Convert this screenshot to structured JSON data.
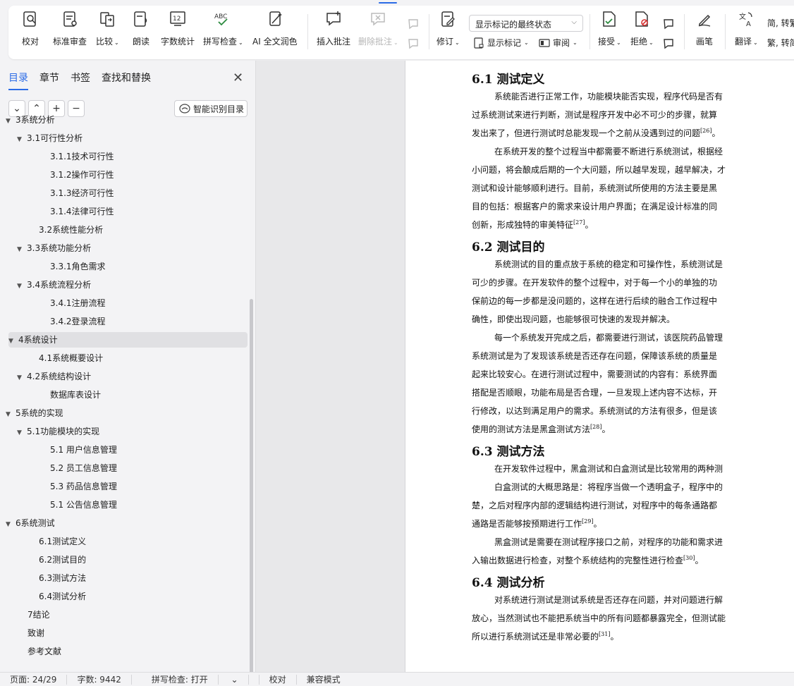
{
  "ribbon": {
    "buttons": [
      {
        "label": "校对"
      },
      {
        "label": "标准审查"
      },
      {
        "label": "比较"
      },
      {
        "label": "朗读"
      },
      {
        "label": "字数统计"
      },
      {
        "label": "拼写检查"
      },
      {
        "label": "AI 全文润色"
      },
      {
        "label": "插入批注"
      },
      {
        "label": "删除批注"
      },
      {
        "label": "修订"
      },
      {
        "label": "接受"
      },
      {
        "label": "拒绝"
      },
      {
        "label": "画笔"
      },
      {
        "label": "翻译"
      }
    ],
    "markup_dropdown": "显示标记的最终状态",
    "show_markup": "显示标记",
    "review_pane": "审阅",
    "convert_1": "简, 转繁",
    "convert_2": "繁, 转简"
  },
  "nav": {
    "tabs": [
      "目录",
      "章节",
      "书签",
      "查找和替换"
    ],
    "smart_toc": "智能识别目录",
    "toc": [
      {
        "text": "3系统分析",
        "level": 0
      },
      {
        "text": "3.1可行性分析",
        "level": 1
      },
      {
        "text": "3.1.1技术可行性",
        "level": 2
      },
      {
        "text": "3.1.2操作可行性",
        "level": 2
      },
      {
        "text": "3.1.3经济可行性",
        "level": 2
      },
      {
        "text": "3.1.4法律可行性",
        "level": 2
      },
      {
        "text": "3.2系统性能分析",
        "level": 1
      },
      {
        "text": "3.3系统功能分析",
        "level": 1
      },
      {
        "text": "3.3.1角色需求",
        "level": 2
      },
      {
        "text": "3.4系统流程分析",
        "level": 1
      },
      {
        "text": "3.4.1注册流程",
        "level": 2
      },
      {
        "text": "3.4.2登录流程",
        "level": 2
      },
      {
        "text": "4系统设计",
        "level": 0
      },
      {
        "text": "4.1系统概要设计",
        "level": 1
      },
      {
        "text": "4.2系统结构设计",
        "level": 1
      },
      {
        "text": "数据库表设计",
        "level": 2
      },
      {
        "text": "5系统的实现",
        "level": 0
      },
      {
        "text": "5.1功能模块的实现",
        "level": 1
      },
      {
        "text": "5.1 用户信息管理",
        "level": 2
      },
      {
        "text": "5.2  员工信息管理",
        "level": 2
      },
      {
        "text": "5.3 药品信息管理",
        "level": 2
      },
      {
        "text": "5.1 公告信息管理",
        "level": 2
      },
      {
        "text": "6系统测试",
        "level": 0
      },
      {
        "text": "6.1测试定义",
        "level": 1
      },
      {
        "text": "6.2测试目的",
        "level": 1
      },
      {
        "text": "6.3测试方法",
        "level": 1
      },
      {
        "text": "6.4测试分析",
        "level": 1
      },
      {
        "text": "7结论",
        "level": 0
      },
      {
        "text": "致谢",
        "level": 0
      },
      {
        "text": "参考文献",
        "level": 0
      }
    ]
  },
  "doc": {
    "s1_title": "6.1  测试定义",
    "s1_p1_l1": "系统能否进行正常工作，功能模块能否实现，程序代码是否有",
    "s1_p1_l2": "过系统测试来进行判断，测试是程序开发中必不可少的步骤，就算",
    "s1_p1_l3": "发出来了，但进行测试时总能发现一个之前从没遇到过的问题",
    "s1_p1_ref": "[26]",
    "s1_p2_l1": "在系统开发的整个过程当中都需要不断进行系统测试，根据经",
    "s1_p2_l2": "小问题，将会酿成后期的一个大问题，所以越早发现，越早解决，才",
    "s1_p2_l3": "测试和设计能够顺利进行。目前，系统测试所使用的方法主要是黑",
    "s1_p2_l4": "目的包括：根据客户的需求来设计用户界面；在满足设计标准的同",
    "s1_p2_l5": "创新，形成独特的审美特征",
    "s1_p2_ref": "[27]",
    "s2_title": "6.2  测试目的",
    "s2_p1_l1": "系统测试的目的重点放于系统的稳定和可操作性，系统测试是",
    "s2_p1_l2": "可少的步骤。在开发软件的整个过程中，对于每一个小的单独的功",
    "s2_p1_l3": "保前边的每一步都是没问题的，这样在进行后续的融合工作过程中",
    "s2_p1_l4": "确性，即使出现问题，也能够很可快速的发现并解决。",
    "s2_p2_l1": "每一个系统发开完成之后，都需要进行测试，该医院药品管理",
    "s2_p2_l2": "系统测试是为了发现该系统是否还存在问题，保障该系统的质量是",
    "s2_p2_l3": "起来比较安心。在进行测试过程中，需要测试的内容有：系统界面",
    "s2_p2_l4": "搭配是否顺眼，功能布局是否合理，一旦发现上述内容不达标，开",
    "s2_p2_l5": "行修改，以达到满足用户的需求。系统测试的方法有很多，但是该",
    "s2_p2_l6": "使用的测试方法是黑盒测试方法",
    "s2_p2_ref": "[28]",
    "s3_title": "6.3  测试方法",
    "s3_p1_l1": "在开发软件过程中，黑盒测试和白盒测试是比较常用的两种测",
    "s3_p2_l1": "白盒测试的大概思路是：将程序当做一个透明盒子，程序中的",
    "s3_p2_l2": "楚，之后对程序内部的逻辑结构进行测试，对程序中的每条通路都",
    "s3_p2_l3": "通路是否能够按预期进行工作",
    "s3_p2_ref": "[29]",
    "s3_p3_l1": "黑盒测试是需要在测试程序接口之前，对程序的功能和需求进",
    "s3_p3_l2": "入输出数据进行检查，对整个系统结构的完整性进行检查",
    "s3_p3_ref": "[30]",
    "s4_title": "6.4  测试分析",
    "s4_p1_l1": "对系统进行测试是测试系统是否还存在问题，并对问题进行解",
    "s4_p1_l2": "放心，当然测试也不能把系统当中的所有问题都暴露完全，但测试能",
    "s4_p1_l3": "所以进行系统测试还是非常必要的",
    "s4_p1_ref": "[31]",
    "period": "。"
  },
  "status": {
    "page": "页面: 24/29",
    "words": "字数: 9442",
    "spell": "拼写检查: 打开",
    "proof": "校对",
    "compat": "兼容模式"
  }
}
